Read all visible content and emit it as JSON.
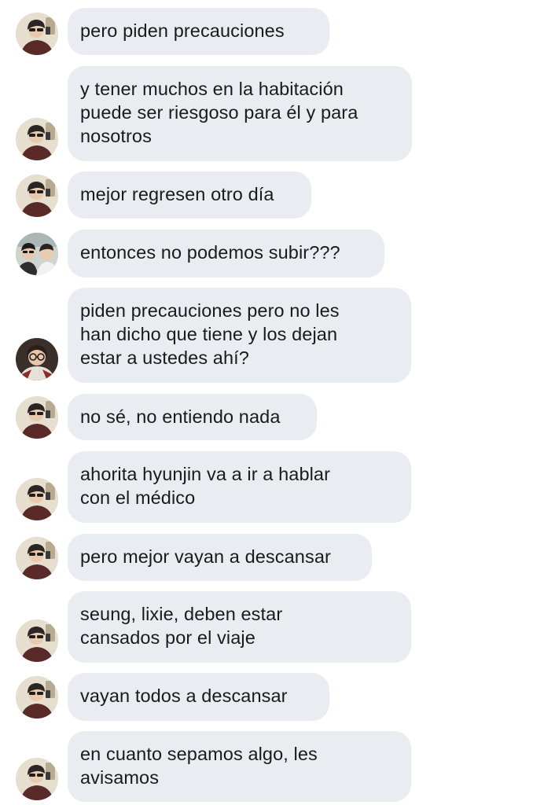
{
  "colors": {
    "bubble": "#e9ecf1",
    "text": "#1a1a1a",
    "background": "#ffffff"
  },
  "messages": [
    {
      "lines": [
        "pero piden precauciones"
      ],
      "avatar": "selfie-avatar-a"
    },
    {
      "lines": [
        "y tener muchos en la habitación",
        "puede ser riesgoso para él y para",
        "nosotros"
      ],
      "avatar": "selfie-avatar-a"
    },
    {
      "lines": [
        "mejor regresen otro día"
      ],
      "avatar": "selfie-avatar-a"
    },
    {
      "lines": [
        "entonces no podemos subir???"
      ],
      "avatar": "duo-avatar-b"
    },
    {
      "lines": [
        "piden precauciones pero no les",
        "han dicho que tiene y los dejan",
        "estar a ustedes ahí?"
      ],
      "avatar": "glasses-avatar-c"
    },
    {
      "lines": [
        "no sé, no entiendo nada"
      ],
      "avatar": "selfie-avatar-a"
    },
    {
      "lines": [
        "ahorita hyunjin va a ir a hablar",
        "con el médico"
      ],
      "avatar": "selfie-avatar-a"
    },
    {
      "lines": [
        "pero mejor vayan a descansar"
      ],
      "avatar": "selfie-avatar-a"
    },
    {
      "lines": [
        "seung, lixie, deben estar",
        "cansados por el viaje"
      ],
      "avatar": "selfie-avatar-a"
    },
    {
      "lines": [
        "vayan todos a descansar"
      ],
      "avatar": "selfie-avatar-a"
    },
    {
      "lines": [
        "en cuanto sepamos algo, les",
        "avisamos"
      ],
      "avatar": "selfie-avatar-a"
    }
  ]
}
